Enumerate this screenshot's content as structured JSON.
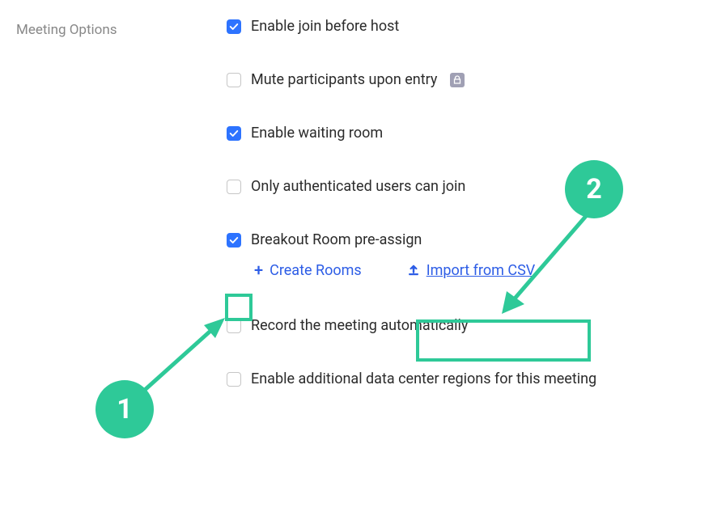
{
  "section": {
    "title": "Meeting Options"
  },
  "options": {
    "enable_join_before_host": {
      "label": "Enable join before host",
      "checked": true
    },
    "mute_on_entry": {
      "label": "Mute participants upon entry",
      "checked": false,
      "locked": true
    },
    "waiting_room": {
      "label": "Enable waiting room",
      "checked": true
    },
    "auth_users_only": {
      "label": "Only authenticated users can join",
      "checked": false
    },
    "breakout_preassign": {
      "label": "Breakout Room pre-assign",
      "checked": true,
      "actions": {
        "create_rooms": "Create Rooms",
        "import_csv": "Import from CSV"
      }
    },
    "record_auto": {
      "label": "Record the meeting automatically",
      "checked": false
    },
    "data_center_regions": {
      "label": "Enable additional data center regions for this meeting",
      "checked": false
    }
  },
  "annotations": {
    "callout_1": "1",
    "callout_2": "2"
  }
}
